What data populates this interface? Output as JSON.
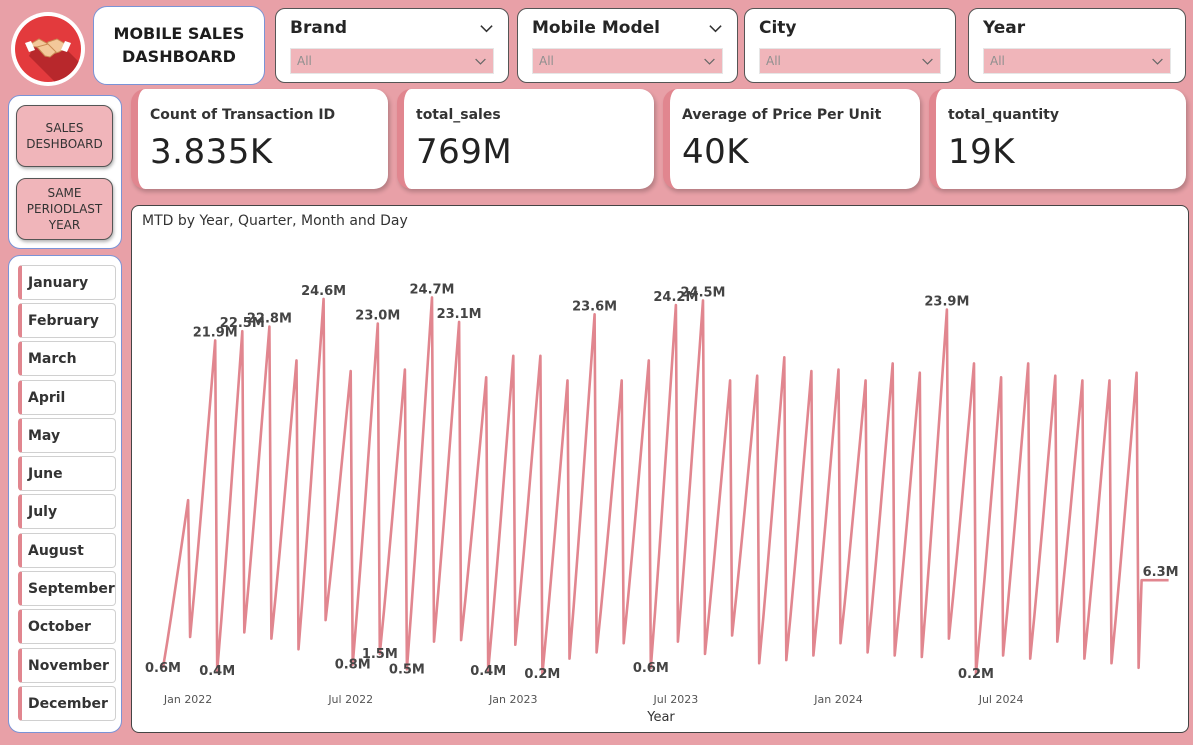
{
  "header": {
    "title_line1": "MOBILE SALES",
    "title_line2": "DASHBOARD"
  },
  "logo": {
    "icon": "handshake-icon",
    "bg_color": "#e33a3d"
  },
  "slicers": [
    {
      "label": "Brand",
      "value": "All"
    },
    {
      "label": "Mobile Model",
      "value": "All"
    },
    {
      "label": "City",
      "value": "All"
    },
    {
      "label": "Year",
      "value": "All"
    }
  ],
  "nav": {
    "sales_dashboard": "SALES DESHBOARD",
    "same_period_line1": "SAME",
    "same_period_line2": "PERIODLAST",
    "same_period_line3": "YEAR"
  },
  "months": [
    "January",
    "February",
    "March",
    "April",
    "May",
    "June",
    "July",
    "August",
    "September",
    "October",
    "November",
    "December"
  ],
  "kpis": [
    {
      "label": "Count of Transaction ID",
      "value": "3.835K"
    },
    {
      "label": "total_sales",
      "value": "769M"
    },
    {
      "label": "Average of Price Per Unit",
      "value": "40K"
    },
    {
      "label": "total_quantity",
      "value": "19K"
    }
  ],
  "colors": {
    "background": "#e8a0a7",
    "accent": "#e1868f",
    "line": "#e1868f",
    "slicer_fill": "#f0b5ba"
  },
  "chart_data": {
    "type": "line",
    "title": "MTD by Year, Quarter, Month and Day",
    "xlabel": "Year",
    "ylabel": "",
    "x_ticks": [
      "Jan 2022",
      "Jul 2022",
      "Jan 2023",
      "Jul 2023",
      "Jan 2024",
      "Jul 2024"
    ],
    "ylim": [
      0,
      27
    ],
    "series": [
      {
        "months": [
          "2021-12",
          "2022-01",
          "2022-02",
          "2022-03",
          "2022-04",
          "2022-05",
          "2022-06",
          "2022-07",
          "2022-08",
          "2022-09",
          "2022-10",
          "2022-11",
          "2022-12",
          "2023-01",
          "2023-02",
          "2023-03",
          "2023-04",
          "2023-05",
          "2023-06",
          "2023-07",
          "2023-08",
          "2023-09",
          "2023-10",
          "2023-11",
          "2023-12",
          "2024-01",
          "2024-02",
          "2024-03",
          "2024-04",
          "2024-05",
          "2024-06",
          "2024-07",
          "2024-08",
          "2024-09",
          "2024-10",
          "2024-11"
        ],
        "month_end_values": [
          11.5,
          21.9,
          22.5,
          22.8,
          20.6,
          24.6,
          19.9,
          23.0,
          20.0,
          24.7,
          23.1,
          19.5,
          20.9,
          20.9,
          19.3,
          23.6,
          19.3,
          20.6,
          24.2,
          24.5,
          19.3,
          19.6,
          20.8,
          19.9,
          20.0,
          19.3,
          20.4,
          19.8,
          23.9,
          20.4,
          19.5,
          20.4,
          19.6,
          19.3,
          19.3,
          19.8
        ],
        "month_start_values": [
          0.6,
          2.6,
          0.4,
          2.9,
          2.5,
          1.8,
          3.7,
          0.8,
          1.5,
          0.5,
          2.3,
          2.4,
          0.4,
          2.1,
          0.2,
          1.2,
          1.6,
          2.2,
          0.6,
          2.3,
          1.5,
          2.7,
          0.9,
          1.1,
          1.4,
          2.2,
          1.6,
          1.4,
          1.3,
          2.5,
          0.2,
          1.4,
          1.2,
          2.3,
          1.2,
          0.9
        ]
      }
    ],
    "end_value": 6.3,
    "data_labels": [
      {
        "month_index": 0,
        "text": "0.6M",
        "pos": "start"
      },
      {
        "month_index": 1,
        "text": "21.9M",
        "pos": "end"
      },
      {
        "month_index": 2,
        "text": "22.5M",
        "pos": "end"
      },
      {
        "month_index": 2,
        "text": "0.4M",
        "pos": "start"
      },
      {
        "month_index": 3,
        "text": "22.8M",
        "pos": "end"
      },
      {
        "month_index": 5,
        "text": "24.6M",
        "pos": "end"
      },
      {
        "month_index": 7,
        "text": "23.0M",
        "pos": "end"
      },
      {
        "month_index": 7,
        "text": "0.8M",
        "pos": "start"
      },
      {
        "month_index": 8,
        "text": "1.5M",
        "pos": "start"
      },
      {
        "month_index": 9,
        "text": "24.7M",
        "pos": "end"
      },
      {
        "month_index": 9,
        "text": "0.5M",
        "pos": "start"
      },
      {
        "month_index": 10,
        "text": "23.1M",
        "pos": "end"
      },
      {
        "month_index": 12,
        "text": "0.4M",
        "pos": "start"
      },
      {
        "month_index": 14,
        "text": "0.2M",
        "pos": "start"
      },
      {
        "month_index": 15,
        "text": "23.6M",
        "pos": "end"
      },
      {
        "month_index": 18,
        "text": "0.6M",
        "pos": "start"
      },
      {
        "month_index": 18,
        "text": "24.2M",
        "pos": "end"
      },
      {
        "month_index": 19,
        "text": "24.5M",
        "pos": "end"
      },
      {
        "month_index": 28,
        "text": "23.9M",
        "pos": "end"
      },
      {
        "month_index": 30,
        "text": "0.2M",
        "pos": "start"
      },
      {
        "month_index": 35,
        "text": "6.3M",
        "pos": "last"
      }
    ],
    "grid": false,
    "legend": "none"
  }
}
